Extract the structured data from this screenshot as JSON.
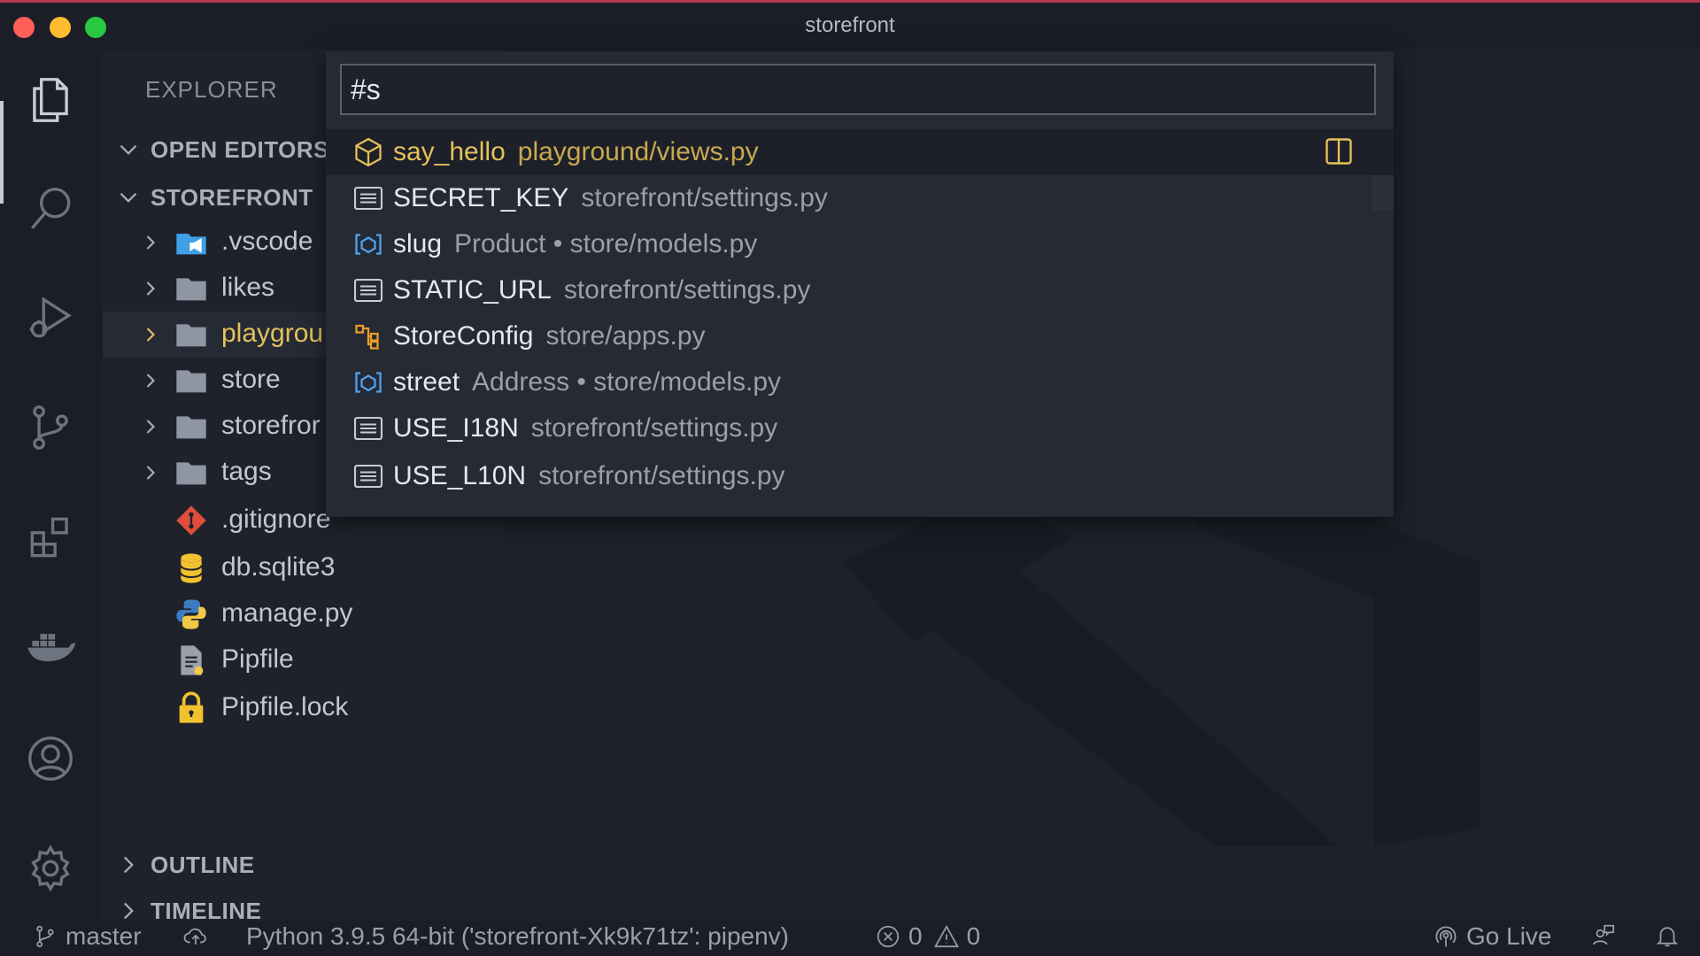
{
  "window": {
    "title": "storefront"
  },
  "explorer": {
    "title": "EXPLORER",
    "open_editors": "OPEN EDITORS",
    "project": "STOREFRONT",
    "items": [
      {
        "label": ".vscode",
        "type": "folder-vscode"
      },
      {
        "label": "likes",
        "type": "folder"
      },
      {
        "label": "playgrou",
        "type": "folder",
        "selected": true
      },
      {
        "label": "store",
        "type": "folder"
      },
      {
        "label": "storefror",
        "type": "folder"
      },
      {
        "label": "tags",
        "type": "folder"
      },
      {
        "label": ".gitignore",
        "type": "git-icon"
      },
      {
        "label": "db.sqlite3",
        "type": "database-icon"
      },
      {
        "label": "manage.py",
        "type": "python-icon"
      },
      {
        "label": "Pipfile",
        "type": "file-icon"
      },
      {
        "label": "Pipfile.lock",
        "type": "lock-icon"
      }
    ],
    "outline": "OUTLINE",
    "timeline": "TIMELINE"
  },
  "quick_open": {
    "query": "#s",
    "results": [
      {
        "name": "say_hello",
        "detail": "playground/views.py",
        "icon": "function-cube-icon"
      },
      {
        "name": "SECRET_KEY",
        "detail": "storefront/settings.py",
        "icon": "variable-icon"
      },
      {
        "name": "slug",
        "detail": "Product • store/models.py",
        "icon": "field-icon"
      },
      {
        "name": "STATIC_URL",
        "detail": "storefront/settings.py",
        "icon": "variable-icon"
      },
      {
        "name": "StoreConfig",
        "detail": "store/apps.py",
        "icon": "class-icon"
      },
      {
        "name": "street",
        "detail": "Address • store/models.py",
        "icon": "field-icon"
      },
      {
        "name": "USE_I18N",
        "detail": "storefront/settings.py",
        "icon": "variable-icon"
      },
      {
        "name": "USE_L10N",
        "detail": "storefront/settings.py",
        "icon": "variable-icon"
      }
    ]
  },
  "statusbar": {
    "branch": "master",
    "python": "Python 3.9.5 64-bit ('storefront-Xk9k71tz': pipenv)",
    "errors": "0",
    "warnings": "0",
    "go_live": "Go Live"
  },
  "colors": {
    "accent_yellow": "#e3c15b",
    "background": "#1e212a",
    "titlebar_accent": "#b5384a"
  }
}
